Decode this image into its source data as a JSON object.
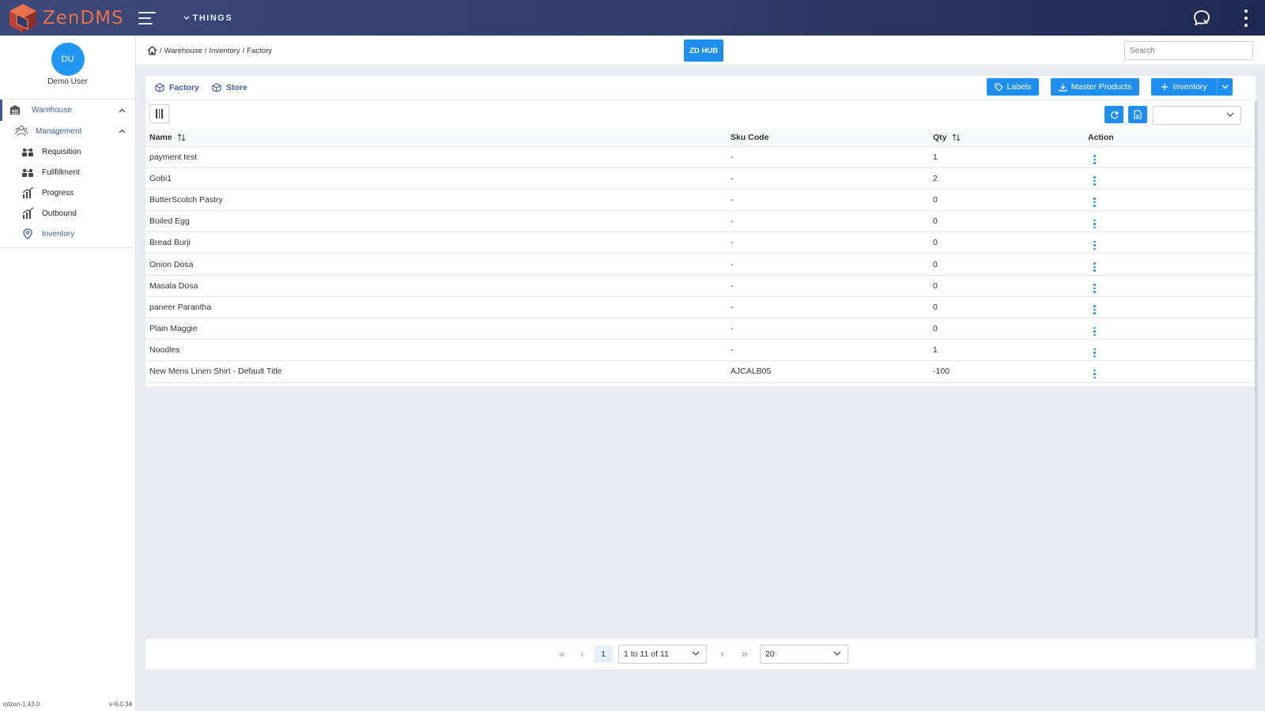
{
  "app": {
    "logo_text": "ZenDMS",
    "things_label": "THINGS"
  },
  "user": {
    "initials": "DU",
    "name": "Demo User"
  },
  "sidebar": {
    "warehouse": "Warehouse",
    "management": "Management",
    "items": [
      {
        "label": "Requisition",
        "icon": "requisition-icon"
      },
      {
        "label": "Fullfillment",
        "icon": "fulfillment-icon"
      },
      {
        "label": "Progress",
        "icon": "progress-icon"
      },
      {
        "label": "Outbound",
        "icon": "outbound-icon"
      },
      {
        "label": "Inventory",
        "icon": "location-pin-icon"
      }
    ],
    "version_left": "iotzen-1.43.0",
    "version_right": "v-9.0.34"
  },
  "header": {
    "breadcrumb": [
      "Warehouse",
      "Inventory",
      "Factory"
    ],
    "hub_label": "ZD HUB",
    "search_placeholder": "Search"
  },
  "tabs": [
    "Factory",
    "Store"
  ],
  "actions": {
    "labels": "Labels",
    "master_products": "Master Products",
    "inventory": "Inventory"
  },
  "table": {
    "columns": [
      "Name",
      "Sku Code",
      "Qty",
      "Action"
    ],
    "rows": [
      {
        "name": "payment test",
        "sku": "-",
        "qty": "1"
      },
      {
        "name": "Gobi1",
        "sku": "-",
        "qty": "2"
      },
      {
        "name": "ButterScotch Pastry",
        "sku": "-",
        "qty": "0"
      },
      {
        "name": "Boiled Egg",
        "sku": "-",
        "qty": "0"
      },
      {
        "name": "Bread Burji",
        "sku": "-",
        "qty": "0"
      },
      {
        "name": "Onion Dosa",
        "sku": "-",
        "qty": "0"
      },
      {
        "name": "Masala Dosa",
        "sku": "-",
        "qty": "0"
      },
      {
        "name": "paneer Parantha",
        "sku": "-",
        "qty": "0"
      },
      {
        "name": "Plain Maggie",
        "sku": "-",
        "qty": "0"
      },
      {
        "name": "Noodles",
        "sku": "-",
        "qty": "1"
      },
      {
        "name": "New Mens Linen Shirt - Default Title",
        "sku": "AJCALB05",
        "qty": "-100"
      }
    ]
  },
  "pagination": {
    "current_page": "1",
    "range": "1 to 11 of 11",
    "page_size": "20"
  },
  "colors": {
    "primary": "#1f8ef1",
    "nav_active": "#3f5a9c",
    "logo": "#e9704c"
  }
}
